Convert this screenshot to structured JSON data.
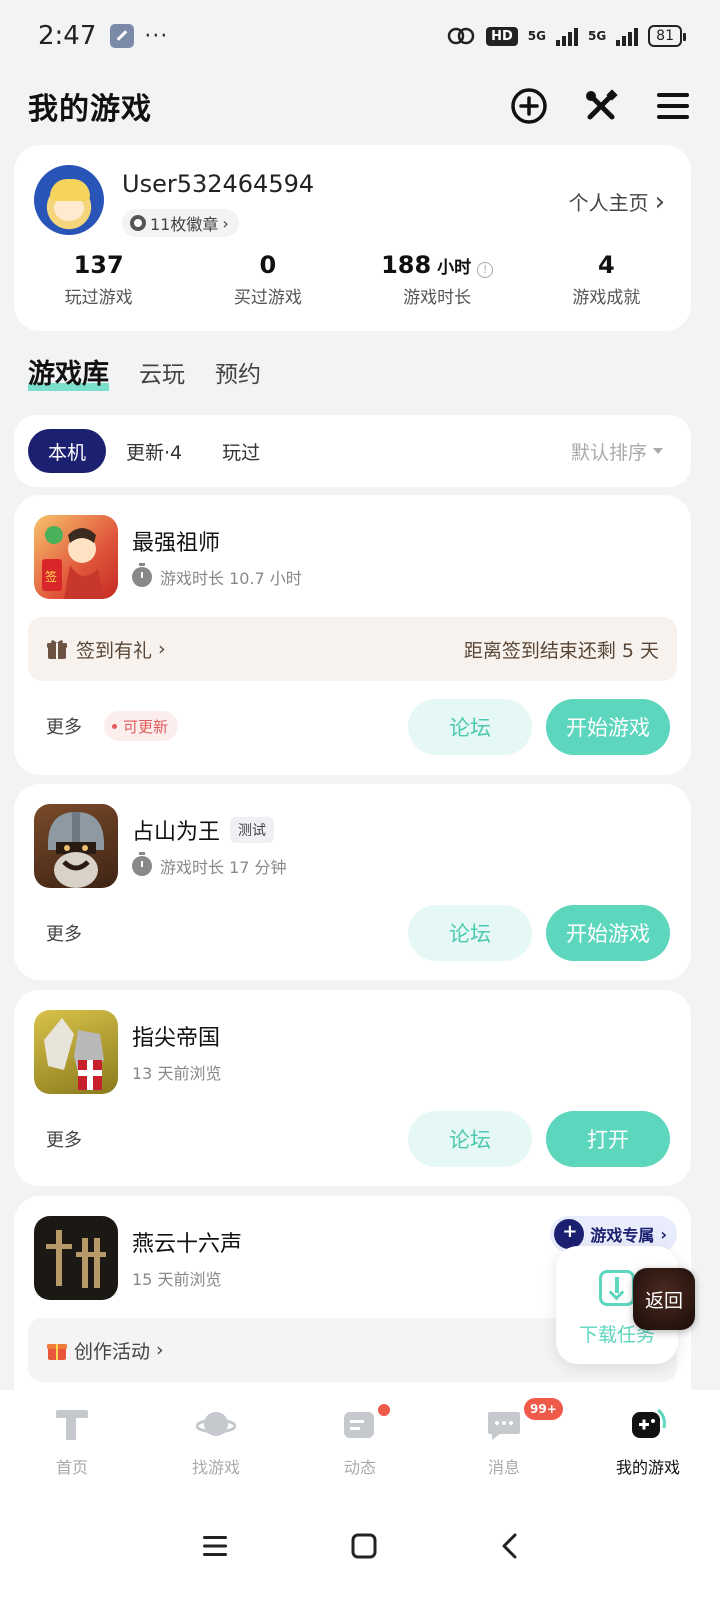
{
  "status_bar": {
    "time": "2:47",
    "dots": "···",
    "hd": "HD",
    "net1": "5G",
    "net2": "5G",
    "battery": "81"
  },
  "header": {
    "title": "我的游戏"
  },
  "profile": {
    "username": "User532464594",
    "badges": "11枚徽章",
    "homepage_link": "个人主页",
    "stats": [
      {
        "value": "137",
        "unit": "",
        "label": "玩过游戏"
      },
      {
        "value": "0",
        "unit": "",
        "label": "买过游戏"
      },
      {
        "value": "188",
        "unit": "小时",
        "label": "游戏时长"
      },
      {
        "value": "4",
        "unit": "",
        "label": "游戏成就"
      }
    ]
  },
  "library_tabs": [
    "游戏库",
    "云玩",
    "预约"
  ],
  "filter": {
    "chips": [
      "本机",
      "更新·4",
      "玩过"
    ],
    "sort": "默认排序"
  },
  "games": [
    {
      "name": "最强祖师",
      "meta": "游戏时长 10.7 小时",
      "checkin_label": "签到有礼",
      "checkin_remaining": "距离签到结束还剩 5 天",
      "more": "更多",
      "update": "可更新",
      "forum": "论坛",
      "action": "开始游戏"
    },
    {
      "name": "占山为王",
      "tag": "测试",
      "meta": "游戏时长 17 分钟",
      "more": "更多",
      "forum": "论坛",
      "action": "开始游戏"
    },
    {
      "name": "指尖帝国",
      "meta": "13 天前浏览",
      "more": "更多",
      "forum": "论坛",
      "action": "打开"
    },
    {
      "name": "燕云十六声",
      "meta": "15 天前浏览",
      "promo": "游戏专属",
      "activity": "创作活动"
    }
  ],
  "floating": {
    "download_label": "下载任务",
    "return_label": "返回"
  },
  "bottom_nav": [
    {
      "label": "首页",
      "icon": "home-icon"
    },
    {
      "label": "找游戏",
      "icon": "planet-icon"
    },
    {
      "label": "动态",
      "icon": "feed-icon"
    },
    {
      "label": "消息",
      "icon": "message-icon",
      "badge": "99+"
    },
    {
      "label": "我的游戏",
      "icon": "gamepad-icon"
    }
  ],
  "colors": {
    "accent": "#5dd6be",
    "navy": "#1c2070",
    "update_red": "#e05b5b"
  }
}
